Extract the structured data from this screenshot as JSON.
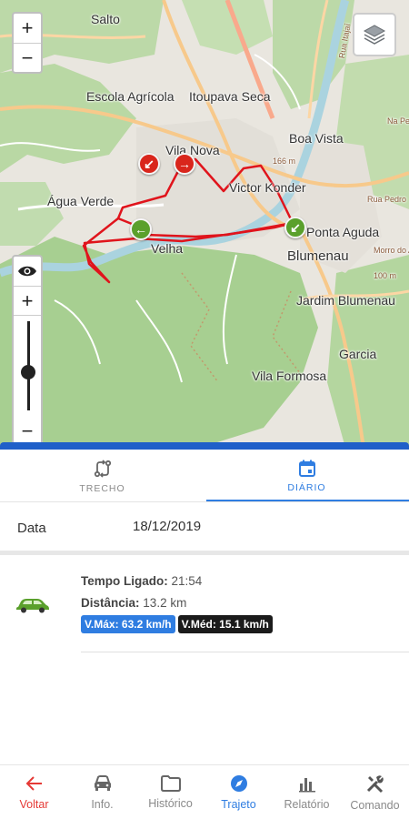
{
  "map": {
    "labels": {
      "salto": "Salto",
      "escola_agricola": "Escola Agrícola",
      "itoupava_seca": "Itoupava Seca",
      "vila_nova": "Vila Nova",
      "boa_vista": "Boa Vista",
      "agua_verde": "Água Verde",
      "victor_konder": "Victor Konder",
      "ponta_aguda": "Ponta Aguda",
      "blumenau": "Blumenau",
      "velha": "Velha",
      "jardim_blumenau": "Jardim Blumenau",
      "garcia": "Garcia",
      "vila_formosa": "Vila Formosa",
      "alt_166": "166 m",
      "alt_morro": "Morro do Aipim",
      "alt_100": "100 m",
      "rua_itajai": "Rua Itajaí",
      "rua_pedro": "Rua Pedro",
      "na_pe": "Na Pe"
    },
    "zoom_in_label": "+",
    "zoom_out_label": "−",
    "side_zoom_in_label": "+",
    "side_zoom_out_label": "−",
    "route_color": "#e0141c",
    "start_marker_color": "#5aa02c",
    "end_marker_color": "#d9261c"
  },
  "tabs": [
    {
      "label": "TRECHO",
      "icon": "swap-route-icon",
      "active": false
    },
    {
      "label": "DIÁRIO",
      "icon": "calendar-icon",
      "active": true
    }
  ],
  "date": {
    "label": "Data",
    "value": "18/12/2019"
  },
  "trip": {
    "tempo_label": "Tempo Ligado:",
    "tempo_value": "21:54",
    "distancia_label": "Distância:",
    "distancia_value": "13.2 km",
    "vmax": "V.Máx: 63.2 km/h",
    "vmed": "V.Méd: 15.1 km/h",
    "icon": "car-icon",
    "car_color": "#5aa02c"
  },
  "bottom_nav": [
    {
      "label": "Voltar",
      "icon": "arrow-left-icon"
    },
    {
      "label": "Info.",
      "icon": "car-icon"
    },
    {
      "label": "Histórico",
      "icon": "folder-icon"
    },
    {
      "label": "Trajeto",
      "icon": "compass-icon"
    },
    {
      "label": "Relatório",
      "icon": "bar-chart-icon"
    },
    {
      "label": "Comando",
      "icon": "tools-icon"
    }
  ],
  "colors": {
    "accent": "#2f7de1",
    "back": "#e53935",
    "map_border": "#1f5fc9"
  }
}
